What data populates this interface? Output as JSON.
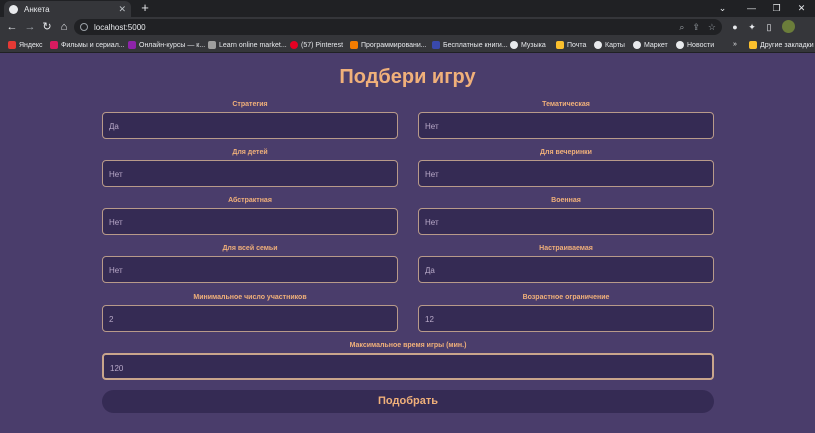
{
  "browser": {
    "tab_title": "Анкета",
    "url": "localhost:5000",
    "bookmarks": [
      "Яндекс",
      "Фильмы и сериал...",
      "Онлайн-курсы — к...",
      "Learn online market...",
      "(57) Pinterest",
      "Программировани...",
      "Бесплатные книги...",
      "Музыка",
      "Почта",
      "Карты",
      "Маркет",
      "Новости"
    ],
    "other_bookmarks": "Другие закладки"
  },
  "page": {
    "title": "Подбери игру",
    "fields": [
      {
        "label": "Стратегия",
        "value": "Да"
      },
      {
        "label": "Тематическая",
        "value": "Нет"
      },
      {
        "label": "Для детей",
        "value": "Нет"
      },
      {
        "label": "Для вечеринки",
        "value": "Нет"
      },
      {
        "label": "Абстрактная",
        "value": "Нет"
      },
      {
        "label": "Военная",
        "value": "Нет"
      },
      {
        "label": "Для всей семьи",
        "value": "Нет"
      },
      {
        "label": "Настраиваемая",
        "value": "Да"
      },
      {
        "label": "Минимальное число участников",
        "value": "2"
      },
      {
        "label": "Возрастное ограничение",
        "value": "12"
      },
      {
        "label": "Максимальное время игры (мин.)",
        "value": "120"
      }
    ],
    "submit_label": "Подобрать"
  },
  "colors": {
    "page_bg": "#4a3d6b",
    "input_bg": "#352b54",
    "accent": "#f0b07a",
    "input_border": "#b89a8a"
  },
  "icons": [
    "globe-icon",
    "close-icon",
    "plus-icon",
    "minimize-icon",
    "maximize-icon",
    "back-arrow-icon",
    "forward-arrow-icon",
    "reload-icon",
    "home-icon",
    "info-icon",
    "zoom-icon",
    "share-icon",
    "star-icon",
    "extension-icon",
    "puzzle-icon",
    "sidebar-icon",
    "chevron-down-icon",
    "folder-icon"
  ]
}
